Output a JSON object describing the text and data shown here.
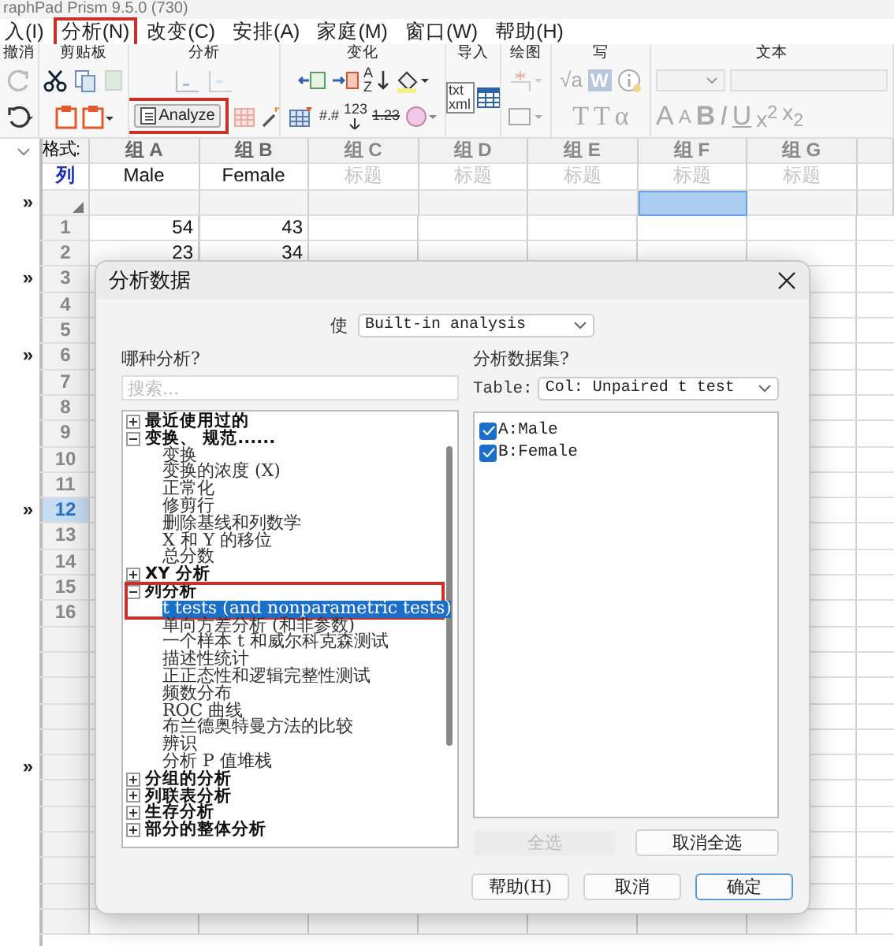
{
  "title_bar": {
    "title": "raphPad Prism 9.5.0 (730)"
  },
  "menu": [
    {
      "label": "入(I)",
      "annotated": false
    },
    {
      "label": "分析(N)",
      "annotated": true
    },
    {
      "label": "改变(C)",
      "annotated": false
    },
    {
      "label": "安排(A)",
      "annotated": false
    },
    {
      "label": "家庭(M)",
      "annotated": false
    },
    {
      "label": "窗口(W)",
      "annotated": false
    },
    {
      "label": "帮助(H)",
      "annotated": false
    }
  ],
  "ribbon": {
    "groups": [
      "撤消",
      "剪贴板",
      "分析",
      "变化",
      "导入",
      "绘图",
      "写",
      "文本"
    ],
    "analyze_button": {
      "label": "Analyze",
      "annotated": true
    },
    "change_labels": [
      "AZ",
      "#.#",
      "123",
      "1.23"
    ],
    "import_labels": [
      "txt",
      "xml"
    ],
    "write_tools": [
      "√a",
      "W",
      "T",
      "T",
      "α"
    ],
    "text_tools": [
      "A",
      "A",
      "B",
      "I",
      "U",
      "x$^{2}$",
      "x$_{2}$"
    ]
  },
  "sheet": {
    "format_label": "格式:",
    "format_value": "列",
    "columns": [
      {
        "group": "组 A",
        "title": "Male",
        "selected": false
      },
      {
        "group": "组 B",
        "title": "Female",
        "selected": false
      },
      {
        "group": "组 C",
        "placeholder": "标题",
        "selected": false
      },
      {
        "group": "组 D",
        "placeholder": "标题",
        "selected": false
      },
      {
        "group": "组 E",
        "placeholder": "标题",
        "selected": false
      },
      {
        "group": "组 F",
        "placeholder": "标题",
        "selected": true
      },
      {
        "group": "组 G",
        "placeholder": "标题",
        "selected": false
      }
    ],
    "rows": [
      {
        "kind": "subheader",
        "side_label": "»"
      },
      {
        "kind": "data",
        "number": "1",
        "values": [
          "54",
          "43"
        ],
        "selected": false
      },
      {
        "kind": "data",
        "number": "2",
        "values": [
          "23",
          "34"
        ],
        "selected": false
      },
      {
        "kind": "data",
        "number": "3",
        "side_label": "»",
        "selected": false
      },
      {
        "kind": "data",
        "number": "4",
        "selected": false
      },
      {
        "kind": "data",
        "number": "5",
        "selected": false
      },
      {
        "kind": "data",
        "number": "6",
        "side_label": "»",
        "selected": false
      },
      {
        "kind": "data",
        "number": "7",
        "selected": false
      },
      {
        "kind": "data",
        "number": "8",
        "selected": false
      },
      {
        "kind": "data",
        "number": "9",
        "selected": false
      },
      {
        "kind": "data",
        "number": "10",
        "selected": false
      },
      {
        "kind": "data",
        "number": "11",
        "selected": false
      },
      {
        "kind": "data",
        "number": "12",
        "side_label": "»",
        "selected": true
      },
      {
        "kind": "data",
        "number": "13",
        "selected": false
      },
      {
        "kind": "data",
        "number": "14",
        "selected": false
      },
      {
        "kind": "data",
        "number": "15",
        "selected": false
      },
      {
        "kind": "data",
        "number": "16",
        "selected": false
      },
      {
        "kind": "data",
        "selected": false
      },
      {
        "kind": "data",
        "selected": false
      },
      {
        "kind": "data",
        "selected": false
      },
      {
        "kind": "data",
        "selected": false
      },
      {
        "kind": "data",
        "selected": false
      },
      {
        "kind": "data",
        "side_label": "»",
        "selected": false
      },
      {
        "kind": "data",
        "selected": false
      },
      {
        "kind": "data",
        "selected": false
      },
      {
        "kind": "data",
        "selected": false
      },
      {
        "kind": "data",
        "selected": false
      },
      {
        "kind": "data",
        "selected": false
      },
      {
        "kind": "data",
        "selected": false
      }
    ]
  },
  "dialog": {
    "title": "分析数据",
    "use_label": "使",
    "use_value": "Built-in analysis",
    "which_label": "哪种分析?",
    "search": {
      "placeholder": "搜索..."
    },
    "tree": [
      {
        "label": "最近使用过的",
        "expanded": false,
        "annotated": false
      },
      {
        "label": "变换、 规范......",
        "expanded": true,
        "annotated": false,
        "children": [
          {
            "label": "变换",
            "selected": false
          },
          {
            "label": "变换的浓度 (X)",
            "selected": false
          },
          {
            "label": "正常化",
            "selected": false
          },
          {
            "label": "修剪行",
            "selected": false
          },
          {
            "label": "删除基线和列数学",
            "selected": false
          },
          {
            "label": "X 和 Y 的移位",
            "selected": false
          },
          {
            "label": "总分数",
            "selected": false
          }
        ]
      },
      {
        "label": "XY 分析",
        "expanded": false,
        "annotated": false
      },
      {
        "label": "列分析",
        "expanded": true,
        "annotated": true,
        "children": [
          {
            "label": "t tests (and nonparametric tests)",
            "selected": true
          },
          {
            "label": "单向方差分析 (和非参数)",
            "selected": false
          },
          {
            "label": "一个样本 t 和威尔科克森测试",
            "selected": false
          },
          {
            "label": "描述性统计",
            "selected": false
          },
          {
            "label": "正正态性和逻辑完整性测试",
            "selected": false
          },
          {
            "label": "频数分布",
            "selected": false
          },
          {
            "label": "ROC 曲线",
            "selected": false
          },
          {
            "label": "布兰德奥特曼方法的比较",
            "selected": false
          },
          {
            "label": "辨识",
            "selected": false
          },
          {
            "label": "分析 P 值堆栈",
            "selected": false
          }
        ]
      },
      {
        "label": "分组的分析",
        "expanded": false,
        "annotated": false
      },
      {
        "label": "列联表分析",
        "expanded": false,
        "annotated": false
      },
      {
        "label": "生存分析",
        "expanded": false,
        "annotated": false
      },
      {
        "label": "部分的整体分析",
        "expanded": false,
        "annotated": false
      }
    ],
    "datasets_label": "分析数据集?",
    "table_label": "Table:",
    "table_value": "Col: Unpaired t test",
    "datasets": [
      {
        "label": "A:Male",
        "checked": true
      },
      {
        "label": "B:Female",
        "checked": true
      }
    ],
    "list_buttons": [
      {
        "label": "全选",
        "disabled": true
      },
      {
        "label": "取消全选",
        "disabled": false
      }
    ],
    "footer_buttons": [
      {
        "label": "帮助(H)",
        "default": false
      },
      {
        "label": "取消",
        "default": false
      },
      {
        "label": "确定",
        "default": true
      }
    ]
  }
}
